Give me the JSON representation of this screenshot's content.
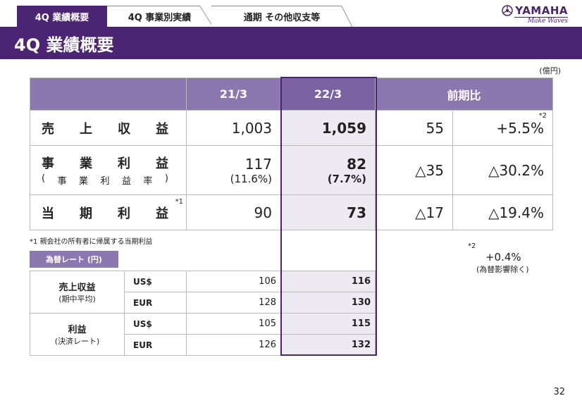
{
  "tabs": [
    "4Q 業績概要",
    "4Q 事業別実績",
    "通期 その他収支等"
  ],
  "logo": {
    "name": "YAMAHA",
    "tagline": "Make Waves"
  },
  "title": "4Q 業績概要",
  "unit": "(億円)",
  "table": {
    "headers": [
      "21/3",
      "22/3",
      "前期比"
    ],
    "rows": [
      {
        "label_chars": [
          "売",
          "上",
          "収",
          "益"
        ],
        "sub_chars": [],
        "mark": "",
        "v1": "1,003",
        "v1_sub": "",
        "v2": "1,059",
        "v2_sub": "",
        "diff": "55",
        "pct": "+5.5%",
        "pct_mark": "*2"
      },
      {
        "label_chars": [
          "事",
          "業",
          "利",
          "益"
        ],
        "sub_chars": [
          "(",
          "事",
          "業",
          "利",
          "益",
          "率",
          ")"
        ],
        "mark": "",
        "v1": "117",
        "v1_sub": "(11.6%)",
        "v2": "82",
        "v2_sub": "(7.7%)",
        "diff": "△35",
        "pct": "△30.2%",
        "pct_mark": ""
      },
      {
        "label_chars": [
          "当",
          "期",
          "利",
          "益"
        ],
        "sub_chars": [],
        "mark": "*1",
        "v1": "90",
        "v1_sub": "",
        "v2": "73",
        "v2_sub": "",
        "diff": "△17",
        "pct": "△19.4%",
        "pct_mark": ""
      }
    ]
  },
  "footnote1": "*1 親会社の所有者に帰属する当期利益",
  "fx": {
    "label": "為替レート (円)",
    "groups": [
      {
        "name": "売上収益",
        "sub": "(期中平均)",
        "rows": [
          {
            "cur": "US$",
            "v1": "106",
            "v2": "116"
          },
          {
            "cur": "EUR",
            "v1": "128",
            "v2": "130"
          }
        ]
      },
      {
        "name": "利益",
        "sub": "(決済レート)",
        "rows": [
          {
            "cur": "US$",
            "v1": "105",
            "v2": "115"
          },
          {
            "cur": "EUR",
            "v1": "126",
            "v2": "132"
          }
        ]
      }
    ]
  },
  "note2": {
    "mark": "*2",
    "value": "+0.4%",
    "desc": "(為替影響除く)"
  },
  "page_number": "32",
  "colors": {
    "primary": "#4b2573",
    "header": "#8b78b0",
    "highlight": "#edeaf2"
  }
}
